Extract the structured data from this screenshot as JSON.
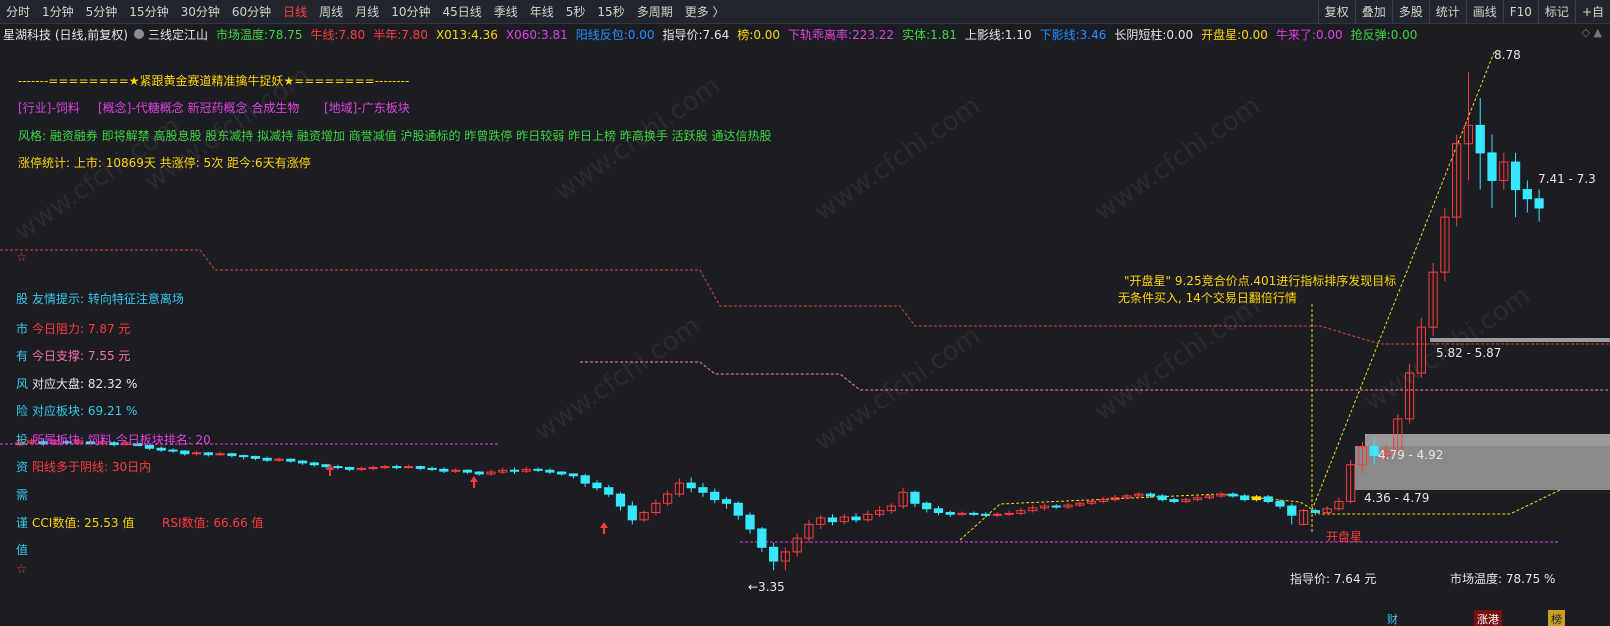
{
  "toolbar": {
    "periods": [
      "分时",
      "1分钟",
      "5分钟",
      "15分钟",
      "30分钟",
      "60分钟",
      "日线",
      "周线",
      "月线",
      "10分钟",
      "45日线",
      "季线",
      "年线",
      "5秒",
      "15秒",
      "多周期",
      "更多 〉"
    ],
    "active_period": "日线",
    "right_buttons": [
      "复权",
      "叠加",
      "多股",
      "统计",
      "画线",
      "F10",
      "标记",
      "+自"
    ]
  },
  "infobar": {
    "stock_name": "星湖科技 (日线,前复权)",
    "indicator_name": "三线定江山",
    "items": [
      {
        "label": "市场温度:",
        "value": "78.75",
        "color": "#3ed43e"
      },
      {
        "label": "牛线:",
        "value": "7.80",
        "color": "#ff3b3b"
      },
      {
        "label": "半年:",
        "value": "7.80",
        "color": "#ff3b3b"
      },
      {
        "label": "X013:",
        "value": "4.36",
        "color": "#ffd400"
      },
      {
        "label": "X060:",
        "value": "3.81",
        "color": "#e040e0"
      },
      {
        "label": "阳线反包:",
        "value": "0.00",
        "color": "#1e90ff"
      },
      {
        "label": "指导价:",
        "value": "7.64",
        "color": "#e6e6e6"
      },
      {
        "label": "榜:",
        "value": "0.00",
        "color": "#ffd400"
      },
      {
        "label": "下轨乖离率:",
        "value": "223.22",
        "color": "#e040e0"
      },
      {
        "label": "实体:",
        "value": "1.81",
        "color": "#3ed43e"
      },
      {
        "label": "上影线:",
        "value": "1.10",
        "color": "#e6e6e6"
      },
      {
        "label": "下影线:",
        "value": "3.46",
        "color": "#1e90ff"
      },
      {
        "label": "长阴短柱:",
        "value": "0.00",
        "color": "#e6e6e6"
      },
      {
        "label": "开盘星:",
        "value": "0.00",
        "color": "#ffd400"
      },
      {
        "label": "牛来了:",
        "value": "0.00",
        "color": "#e040e0"
      },
      {
        "label": "抢反弹:",
        "value": "0.00",
        "color": "#3ed43e"
      }
    ],
    "right_icons": "◇ ▲"
  },
  "overlay": {
    "banner": "-------========★紧跟黄金赛道精准擒牛捉妖★========--------",
    "industry": "[行业]-饲料",
    "concept": "[概念]-代糖概念 新冠药概念 合成生物",
    "region": "[地域]-广东板块",
    "style": "风格: 融资融券 即将解禁 高股息股 股东减持 拟减持 融资增加 商誉减值 沪股通标的 昨曾跌停 昨日较弱 昨日上榜 昨高换手 活跃股 通达信热股",
    "limit_stats": "涨停统计:   上市: 10869天    共涨停: 5次    距今:6天有涨停",
    "star": "☆",
    "side_lines": [
      {
        "prefix": "股",
        "text": "友情提示:    转向特征注意离场",
        "color": "#37c8e8"
      },
      {
        "prefix": "市",
        "text": "今日阻力:   7.87 元",
        "color": "#ff3b3b"
      },
      {
        "prefix": "有",
        "text": "今日支撑:   7.55 元",
        "color": "#ff6fa8"
      },
      {
        "prefix": "风",
        "text": "对应大盘:    82.32 %",
        "color": "#e6e6e6"
      },
      {
        "prefix": "险",
        "text": "对应板块:    69.21 %",
        "color": "#37c8e8"
      },
      {
        "prefix": "投",
        "text": "所属板块:    饲料         今日板块排名:  20",
        "color": "#e040e0"
      },
      {
        "prefix": "资",
        "text": "阳线多于阴线:   30日内",
        "color": "#ff3b3b"
      },
      {
        "prefix": "需",
        "text": "",
        "color": "#37c8e8"
      },
      {
        "prefix": "谨",
        "text": "CCI数值:    25.53 值",
        "color": "#ffd400"
      },
      {
        "prefix": "",
        "text": "RSI数值:    66.66 值",
        "color": "#ff3b3b"
      },
      {
        "prefix": "值",
        "text": "",
        "color": "#37c8e8"
      },
      {
        "prefix": "☆",
        "text": "",
        "color": "#ff3b3b"
      }
    ],
    "annotation_line1": "\"开盘星\"  9.25竞合价点.401进行指标排序发现目标",
    "annotation_line2": "无条件买入,  14个交易日翻倍行情",
    "kaipanxing_label": "开盘星",
    "bottom_guide": "指导价:   7.64 元",
    "bottom_temp": "市场温度:    78.75 %",
    "bottom_badges": [
      "财",
      "涨港",
      "榜"
    ],
    "watermark": "www.cfchi.com"
  },
  "chart_data": {
    "type": "candlestick",
    "price_labels": [
      {
        "text": "8.78"
      },
      {
        "text": "7.41 - 7.3"
      },
      {
        "text": "5.82 - 5.87"
      },
      {
        "text": "4.79 - 4.92"
      },
      {
        "text": "4.36 - 4.79"
      },
      {
        "text": "←3.35"
      }
    ],
    "ylim": [
      3.2,
      9.0
    ],
    "candles": [
      [
        4.72,
        4.74,
        4.7,
        4.77
      ],
      [
        4.74,
        4.76,
        4.72,
        4.79
      ],
      [
        4.75,
        4.73,
        4.71,
        4.78
      ],
      [
        4.73,
        4.76,
        4.72,
        4.78
      ],
      [
        4.75,
        4.74,
        4.72,
        4.77
      ],
      [
        4.74,
        4.76,
        4.73,
        4.78
      ],
      [
        4.75,
        4.73,
        4.72,
        4.77
      ],
      [
        4.73,
        4.75,
        4.71,
        4.77
      ],
      [
        4.74,
        4.72,
        4.7,
        4.76
      ],
      [
        4.72,
        4.74,
        4.71,
        4.76
      ],
      [
        4.73,
        4.71,
        4.7,
        4.75
      ],
      [
        4.71,
        4.68,
        4.66,
        4.72
      ],
      [
        4.68,
        4.66,
        4.64,
        4.7
      ],
      [
        4.66,
        4.65,
        4.63,
        4.68
      ],
      [
        4.65,
        4.62,
        4.6,
        4.66
      ],
      [
        4.62,
        4.63,
        4.6,
        4.65
      ],
      [
        4.63,
        4.61,
        4.59,
        4.64
      ],
      [
        4.61,
        4.62,
        4.6,
        4.64
      ],
      [
        4.62,
        4.6,
        4.58,
        4.63
      ],
      [
        4.6,
        4.59,
        4.56,
        4.61
      ],
      [
        4.59,
        4.57,
        4.55,
        4.6
      ],
      [
        4.57,
        4.55,
        4.53,
        4.59
      ],
      [
        4.55,
        4.56,
        4.53,
        4.58
      ],
      [
        4.56,
        4.54,
        4.52,
        4.57
      ],
      [
        4.54,
        4.52,
        4.5,
        4.55
      ],
      [
        4.52,
        4.5,
        4.48,
        4.53
      ],
      [
        4.5,
        4.48,
        4.46,
        4.51
      ],
      [
        4.48,
        4.47,
        4.45,
        4.5
      ],
      [
        4.47,
        4.45,
        4.43,
        4.48
      ],
      [
        4.45,
        4.46,
        4.43,
        4.48
      ],
      [
        4.46,
        4.47,
        4.44,
        4.49
      ],
      [
        4.47,
        4.48,
        4.45,
        4.5
      ],
      [
        4.48,
        4.47,
        4.45,
        4.5
      ],
      [
        4.47,
        4.48,
        4.46,
        4.5
      ],
      [
        4.48,
        4.46,
        4.44,
        4.49
      ],
      [
        4.46,
        4.45,
        4.43,
        4.48
      ],
      [
        4.45,
        4.43,
        4.41,
        4.47
      ],
      [
        4.43,
        4.44,
        4.41,
        4.46
      ],
      [
        4.44,
        4.42,
        4.4,
        4.45
      ],
      [
        4.42,
        4.4,
        4.38,
        4.43
      ],
      [
        4.4,
        4.42,
        4.38,
        4.45
      ],
      [
        4.42,
        4.44,
        4.4,
        4.47
      ],
      [
        4.44,
        4.43,
        4.4,
        4.47
      ],
      [
        4.43,
        4.45,
        4.41,
        4.48
      ],
      [
        4.45,
        4.44,
        4.42,
        4.47
      ],
      [
        4.44,
        4.42,
        4.4,
        4.46
      ],
      [
        4.42,
        4.4,
        4.38,
        4.43
      ],
      [
        4.4,
        4.38,
        4.35,
        4.41
      ],
      [
        4.38,
        4.3,
        4.26,
        4.4
      ],
      [
        4.3,
        4.25,
        4.22,
        4.33
      ],
      [
        4.25,
        4.18,
        4.15,
        4.28
      ],
      [
        4.18,
        4.05,
        4.0,
        4.2
      ],
      [
        4.05,
        3.9,
        3.85,
        4.1
      ],
      [
        3.9,
        3.98,
        3.88,
        4.0
      ],
      [
        3.98,
        4.08,
        3.95,
        4.12
      ],
      [
        4.08,
        4.18,
        4.05,
        4.22
      ],
      [
        4.18,
        4.3,
        4.15,
        4.35
      ],
      [
        4.3,
        4.25,
        4.2,
        4.36
      ],
      [
        4.25,
        4.2,
        4.15,
        4.3
      ],
      [
        4.2,
        4.12,
        4.08,
        4.24
      ],
      [
        4.12,
        4.08,
        4.02,
        4.15
      ],
      [
        4.08,
        3.95,
        3.9,
        4.1
      ],
      [
        3.95,
        3.8,
        3.75,
        3.98
      ],
      [
        3.8,
        3.6,
        3.55,
        3.82
      ],
      [
        3.6,
        3.45,
        3.35,
        3.65
      ],
      [
        3.45,
        3.55,
        3.35,
        3.6
      ],
      [
        3.55,
        3.7,
        3.5,
        3.75
      ],
      [
        3.7,
        3.85,
        3.65,
        3.9
      ],
      [
        3.85,
        3.92,
        3.8,
        3.95
      ],
      [
        3.92,
        3.88,
        3.84,
        3.96
      ],
      [
        3.88,
        3.93,
        3.85,
        3.96
      ],
      [
        3.93,
        3.9,
        3.87,
        3.97
      ],
      [
        3.9,
        3.96,
        3.88,
        4.0
      ],
      [
        3.96,
        4.0,
        3.93,
        4.05
      ],
      [
        4.0,
        4.05,
        3.97,
        4.08
      ],
      [
        4.05,
        4.2,
        4.02,
        4.25
      ],
      [
        4.2,
        4.08,
        4.04,
        4.22
      ],
      [
        4.08,
        4.02,
        3.98,
        4.1
      ],
      [
        4.02,
        3.98,
        3.95,
        4.05
      ],
      [
        3.98,
        3.96,
        3.93,
        4.0
      ],
      [
        3.96,
        3.97,
        3.94,
        3.99
      ],
      [
        3.97,
        3.96,
        3.94,
        3.99
      ],
      [
        3.96,
        3.95,
        3.93,
        3.98
      ],
      [
        3.95,
        3.96,
        3.93,
        3.98
      ],
      [
        3.96,
        3.97,
        3.94,
        4.0
      ],
      [
        3.97,
        4.0,
        3.95,
        4.03
      ],
      [
        4.0,
        4.03,
        3.98,
        4.06
      ],
      [
        4.03,
        4.05,
        4.0,
        4.08
      ],
      [
        4.05,
        4.04,
        4.02,
        4.07
      ],
      [
        4.04,
        4.06,
        4.02,
        4.08
      ],
      [
        4.06,
        4.08,
        4.04,
        4.1
      ],
      [
        4.08,
        4.1,
        4.06,
        4.12
      ],
      [
        4.1,
        4.12,
        4.08,
        4.15
      ],
      [
        4.12,
        4.14,
        4.1,
        4.17
      ],
      [
        4.14,
        4.16,
        4.12,
        4.18
      ],
      [
        4.16,
        4.18,
        4.13,
        4.2
      ],
      [
        4.18,
        4.16,
        4.14,
        4.2
      ],
      [
        4.16,
        4.12,
        4.1,
        4.18
      ],
      [
        4.12,
        4.1,
        4.08,
        4.14
      ],
      [
        4.1,
        4.12,
        4.08,
        4.14
      ],
      [
        4.12,
        4.14,
        4.1,
        4.16
      ],
      [
        4.14,
        4.16,
        4.12,
        4.18
      ],
      [
        4.16,
        4.18,
        4.14,
        4.2
      ],
      [
        4.18,
        4.16,
        4.14,
        4.2
      ],
      [
        4.16,
        4.12,
        4.1,
        4.18
      ],
      [
        4.12,
        4.15,
        4.1,
        4.17
      ],
      [
        4.15,
        4.1,
        4.08,
        4.17
      ],
      [
        4.1,
        4.05,
        4.02,
        4.12
      ],
      [
        4.05,
        3.95,
        3.85,
        4.08
      ],
      [
        3.85,
        4.0,
        3.84,
        4.02
      ],
      [
        4.0,
        3.98,
        3.95,
        4.02
      ],
      [
        3.98,
        4.02,
        3.96,
        4.05
      ],
      [
        4.02,
        4.1,
        4.0,
        4.14
      ],
      [
        4.1,
        4.5,
        4.08,
        4.55
      ],
      [
        4.5,
        4.7,
        4.4,
        4.75
      ],
      [
        4.7,
        4.6,
        4.5,
        4.8
      ],
      [
        4.6,
        4.65,
        4.55,
        4.72
      ],
      [
        4.65,
        5.0,
        4.6,
        5.05
      ],
      [
        5.0,
        5.5,
        4.95,
        5.6
      ],
      [
        5.5,
        6.0,
        5.45,
        6.1
      ],
      [
        6.0,
        6.6,
        5.9,
        6.7
      ],
      [
        6.6,
        7.2,
        6.5,
        7.3
      ],
      [
        7.2,
        8.0,
        7.1,
        8.1
      ],
      [
        8.0,
        8.2,
        7.6,
        8.78
      ],
      [
        8.2,
        7.9,
        7.5,
        8.5
      ],
      [
        7.9,
        7.6,
        7.3,
        8.1
      ],
      [
        7.6,
        7.8,
        7.5,
        7.9
      ],
      [
        7.8,
        7.5,
        7.2,
        7.9
      ],
      [
        7.5,
        7.4,
        7.25,
        7.6
      ],
      [
        7.4,
        7.3,
        7.15,
        7.5
      ]
    ]
  },
  "colors": {
    "up": "#ff3b3b",
    "down": "#37e8ff",
    "dash_red": "#d94040",
    "dash_yellow": "#ffd400",
    "dash_magenta": "#e040e0",
    "gray_band": "#9a9a9a",
    "green_candle": "#1fdc1f",
    "yellow_candle": "#ffe000"
  }
}
